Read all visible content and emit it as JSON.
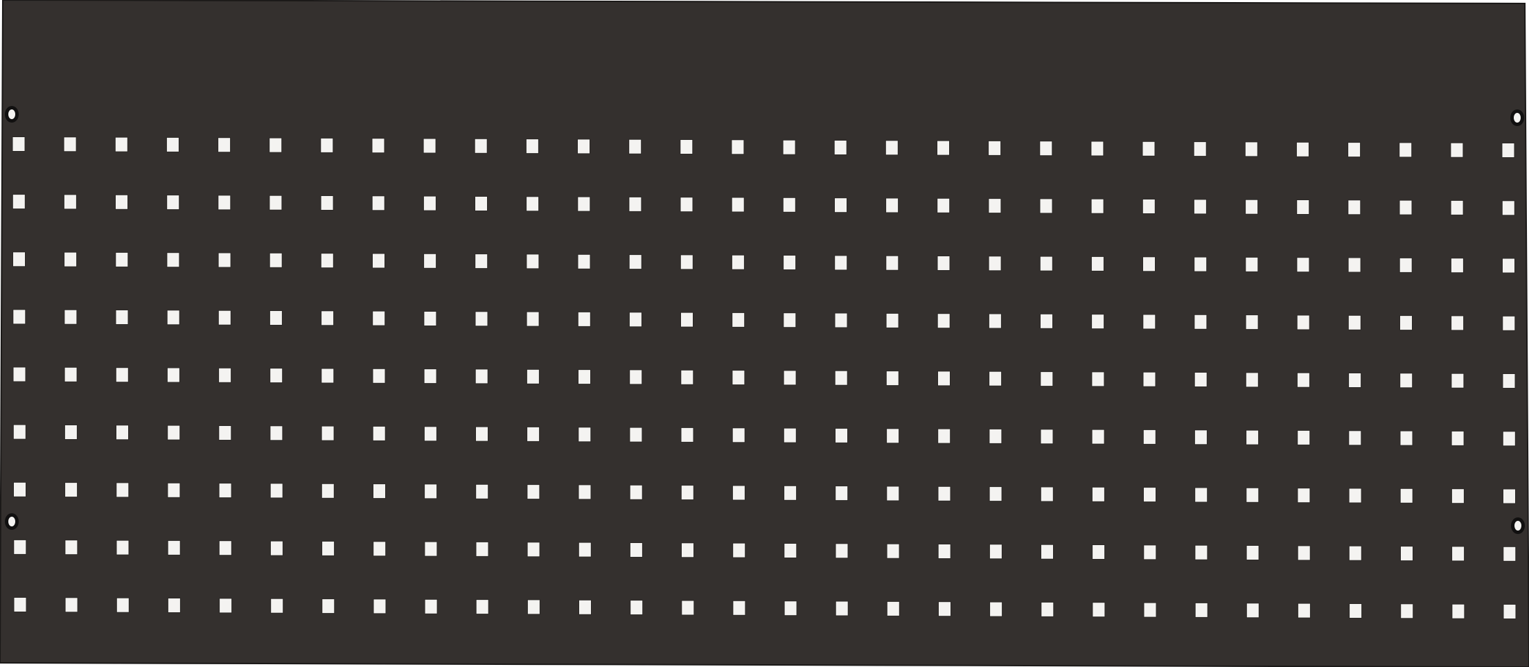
{
  "image": {
    "subject": "pegboard-panel",
    "colors": {
      "panel": "#34302e",
      "panel_edge": "#1b1918",
      "hole": "#f4f3f1",
      "hole_edge": "#2a2725",
      "background": "#ffffff"
    },
    "grid": {
      "rows": 9,
      "columns": 30
    },
    "mounting_holes": {
      "count": 4
    }
  }
}
